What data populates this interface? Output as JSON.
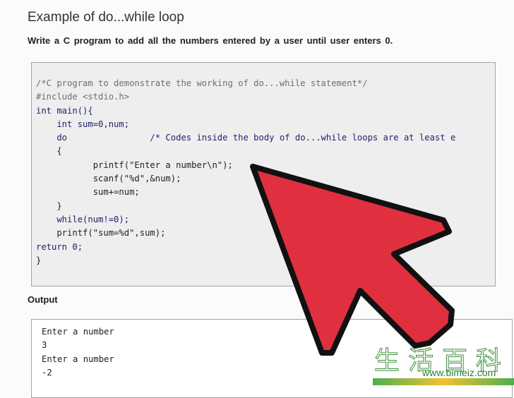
{
  "title": "Example of do...while loop",
  "task": "Write a C program to add all the numbers entered by a user until user enters 0.",
  "code_lines": [
    "/*C program to demonstrate the working of do...while statement*/",
    "#include <stdio.h>",
    "int main(){",
    "    int sum=0,num;",
    "    do                /* Codes inside the body of do...while loops are at least e",
    "    {",
    "           printf(\"Enter a number\\n\");",
    "           scanf(\"%d\",&num);",
    "           sum+=num;",
    "    }",
    "    while(num!=0);",
    "    printf(\"sum=%d\",sum);",
    "return 0;",
    "}"
  ],
  "output_label": "Output",
  "output_lines": [
    "Enter a number",
    "3",
    "Enter a number",
    "-2"
  ],
  "arrow_color": "#e0303f",
  "watermark": {
    "chinese": "生活百科",
    "url": "www.bimeiz.com"
  }
}
